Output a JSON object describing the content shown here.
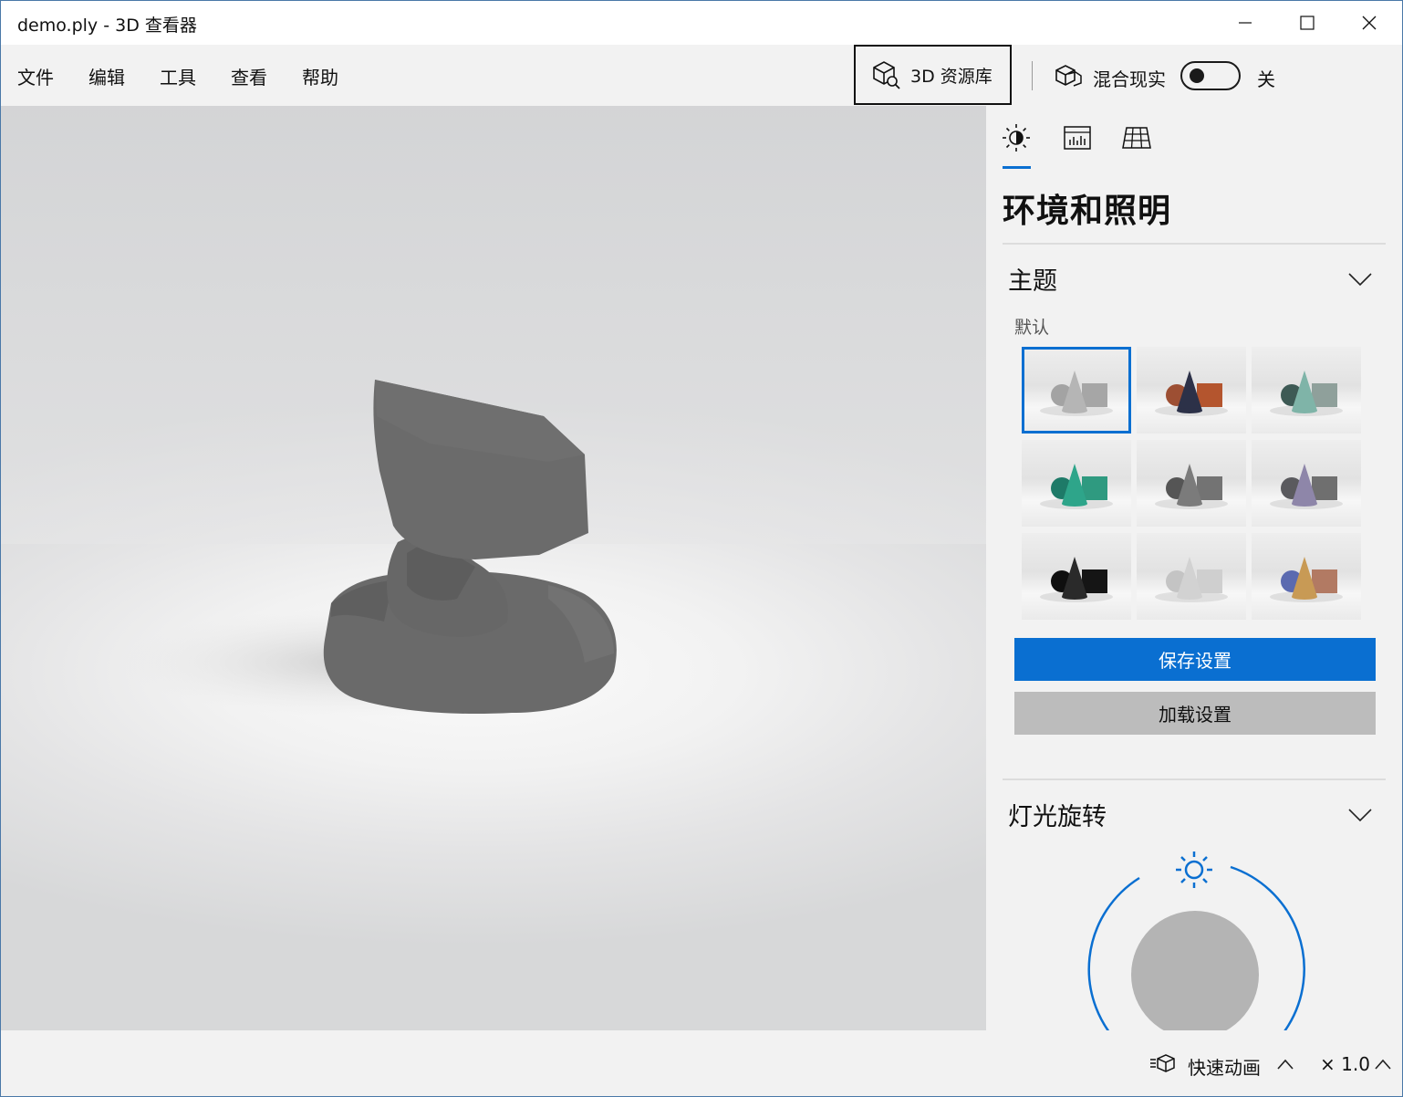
{
  "window": {
    "title": "demo.ply - 3D 查看器",
    "controls": [
      "minimize",
      "maximize",
      "close"
    ]
  },
  "menu": {
    "items": [
      "文件",
      "编辑",
      "工具",
      "查看",
      "帮助"
    ],
    "asset_library_label": "3D 资源库",
    "mixed_reality_label": "混合现实",
    "mixed_reality_state": "关"
  },
  "panel": {
    "tabs": [
      "sun-icon",
      "stats-icon",
      "grid-icon"
    ],
    "title": "环境和照明",
    "theme_section": {
      "title": "主题",
      "subtitle": "默认",
      "selected_index": 0,
      "themes": [
        {
          "cone": "#b5b5b5",
          "sphere": "#a3a3a3",
          "box": "#a6a6a6"
        },
        {
          "cone": "#2c3148",
          "sphere": "#9d4f33",
          "box": "#b4552e"
        },
        {
          "cone": "#7fb4a8",
          "sphere": "#3e5a55",
          "box": "#8fa09b"
        },
        {
          "cone": "#2ea58a",
          "sphere": "#1e7a68",
          "box": "#2f9a80"
        },
        {
          "cone": "#7b7b7b",
          "sphere": "#555555",
          "box": "#737373"
        },
        {
          "cone": "#8e86a9",
          "sphere": "#5a5a5e",
          "box": "#6f6f6f"
        },
        {
          "cone": "#2a2a2a",
          "sphere": "#0f0f0f",
          "box": "#151515"
        },
        {
          "cone": "#d2d2d2",
          "sphere": "#c4c4c4",
          "box": "#cfcfcf"
        },
        {
          "cone": "#c89a55",
          "sphere": "#5b6ab0",
          "box": "#b27a63"
        }
      ],
      "save_label": "保存设置",
      "load_label": "加载设置"
    },
    "light_section": {
      "title": "灯光旋转"
    }
  },
  "status": {
    "animation_label": "快速动画",
    "speed": "× 1.0"
  }
}
